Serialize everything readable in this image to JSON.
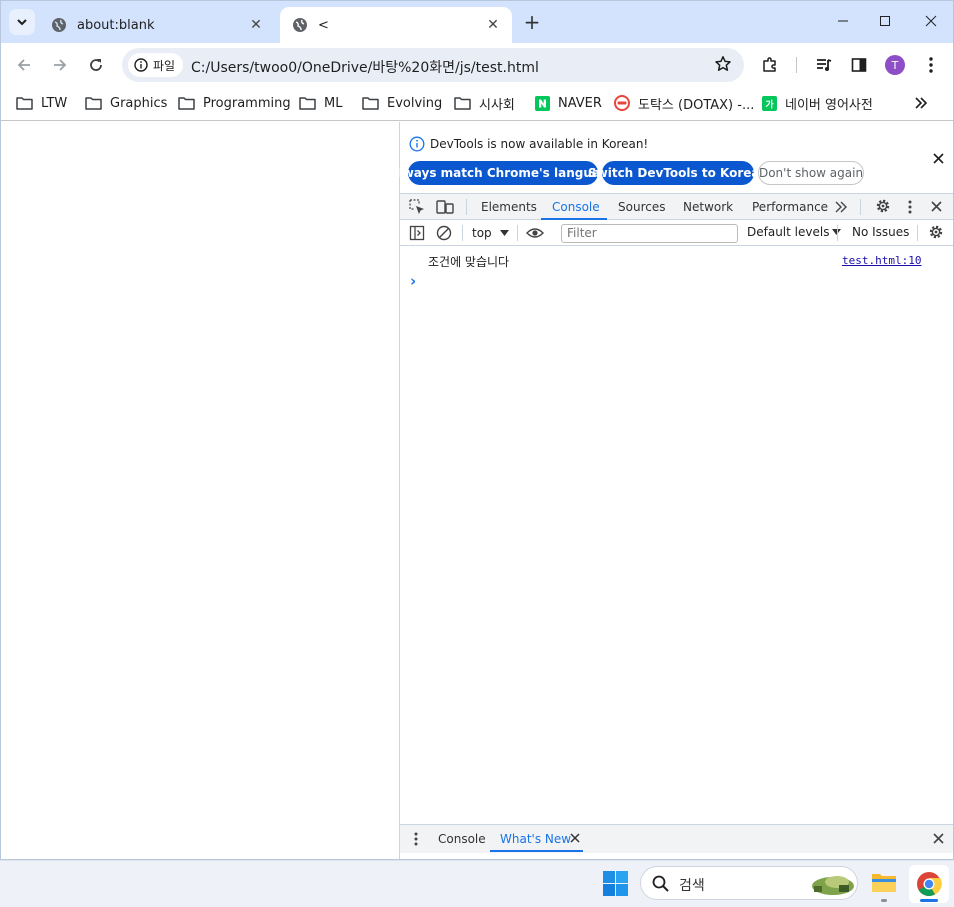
{
  "browser": {
    "tabs": [
      {
        "title": "about:blank",
        "active": false
      },
      {
        "title": "<",
        "active": true
      }
    ],
    "address": {
      "chip_label": "파일",
      "url": "C:/Users/twoo0/OneDrive/바탕%20화면/js/test.html"
    },
    "profile_initial": "T",
    "bookmarks": [
      {
        "label": "LTW",
        "icon": "folder-icon"
      },
      {
        "label": "Graphics",
        "icon": "folder-icon"
      },
      {
        "label": "Programming",
        "icon": "folder-icon"
      },
      {
        "label": "ML",
        "icon": "folder-icon"
      },
      {
        "label": "Evolving",
        "icon": "folder-icon"
      },
      {
        "label": "시사회",
        "icon": "folder-icon"
      },
      {
        "label": "NAVER",
        "icon": "naver-icon"
      },
      {
        "label": "도탁스 (DOTAX) -...",
        "icon": "dotax-icon"
      },
      {
        "label": "네이버 영어사전",
        "icon": "naver-dict-icon"
      }
    ]
  },
  "devtools": {
    "infobar": {
      "message": "DevTools is now available in Korean!",
      "buttons": [
        "Always match Chrome's language",
        "Switch DevTools to Korean",
        "Don't show again"
      ]
    },
    "tabs": [
      "Elements",
      "Console",
      "Sources",
      "Network",
      "Performance"
    ],
    "active_tab": "Console",
    "console_toolbar": {
      "context": "top",
      "filter_placeholder": "Filter",
      "levels": "Default levels",
      "issues": "No Issues"
    },
    "messages": [
      {
        "text": "조건에 맞습니다",
        "source": "test.html:10"
      }
    ],
    "prompt": "›",
    "drawer_tabs": [
      "Console",
      "What's New"
    ],
    "drawer_active": "What's New"
  },
  "taskbar": {
    "search_placeholder": "검색"
  },
  "colors": {
    "titlebar": "#d3e3fd",
    "accent": "#0b57d0",
    "devtools_active": "#1a73e8",
    "link": "#1a0dab"
  }
}
